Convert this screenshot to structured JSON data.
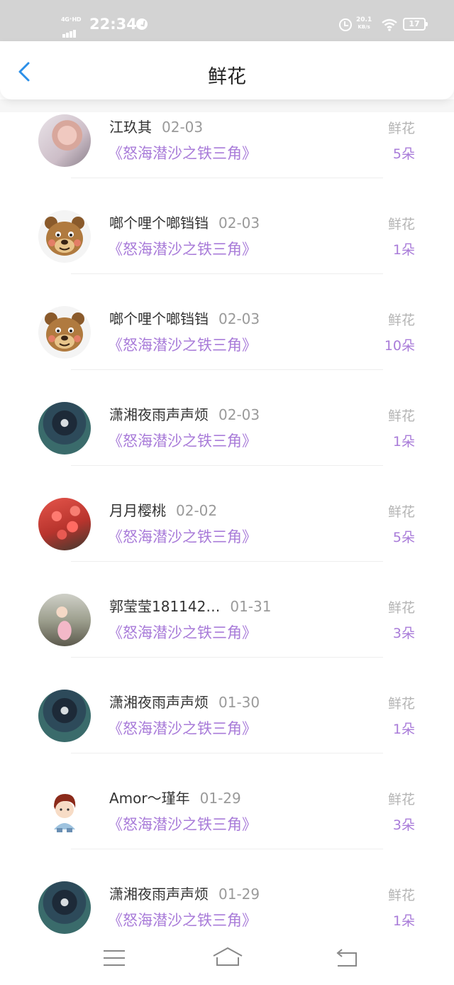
{
  "status_bar": {
    "network": "4G⁺HD",
    "time": "22:34",
    "speed_value": "20.1",
    "speed_unit": "KB/s",
    "battery": "17",
    "icons": [
      "signal-icon",
      "clock-icon",
      "alarm-icon",
      "wifi-icon",
      "battery-icon"
    ]
  },
  "header": {
    "title": "鲜花",
    "back_icon": "chevron-left-icon",
    "accent_color": "#2b8fe8"
  },
  "colors": {
    "book": "#a97cd9",
    "count": "#a97cd9",
    "type": "#b4b4b4",
    "name": "#333333",
    "date": "#9a9a9a"
  },
  "items": [
    {
      "name": "江玖其",
      "date": "02-03",
      "book": "《怒海潜沙之铁三角》",
      "type": "鲜花",
      "count": "5朵",
      "avatar": "hand-photo"
    },
    {
      "name": "啷个哩个啷铛铛",
      "date": "02-03",
      "book": "《怒海潜沙之铁三角》",
      "type": "鲜花",
      "count": "1朵",
      "avatar": "bear-cartoon"
    },
    {
      "name": "啷个哩个啷铛铛",
      "date": "02-03",
      "book": "《怒海潜沙之铁三角》",
      "type": "鲜花",
      "count": "10朵",
      "avatar": "bear-cartoon"
    },
    {
      "name": "潇湘夜雨声声烦",
      "date": "02-03",
      "book": "《怒海潜沙之铁三角》",
      "type": "鲜花",
      "count": "1朵",
      "avatar": "hooded-figure"
    },
    {
      "name": "月月樱桃",
      "date": "02-02",
      "book": "《怒海潜沙之铁三角》",
      "type": "鲜花",
      "count": "5朵",
      "avatar": "red-flowers"
    },
    {
      "name": "郭莹莹181142…",
      "date": "01-31",
      "book": "《怒海潜沙之铁三角》",
      "type": "鲜花",
      "count": "3朵",
      "avatar": "child-photo"
    },
    {
      "name": "潇湘夜雨声声烦",
      "date": "01-30",
      "book": "《怒海潜沙之铁三角》",
      "type": "鲜花",
      "count": "1朵",
      "avatar": "hooded-figure"
    },
    {
      "name": "Amor～瑾年",
      "date": "01-29",
      "book": "《怒海潜沙之铁三角》",
      "type": "鲜花",
      "count": "3朵",
      "avatar": "anime-boy"
    },
    {
      "name": "潇湘夜雨声声烦",
      "date": "01-29",
      "book": "《怒海潜沙之铁三角》",
      "type": "鲜花",
      "count": "1朵",
      "avatar": "hooded-figure"
    }
  ],
  "bottom_nav": {
    "icons": [
      "menu-icon",
      "home-icon",
      "back-icon"
    ]
  }
}
